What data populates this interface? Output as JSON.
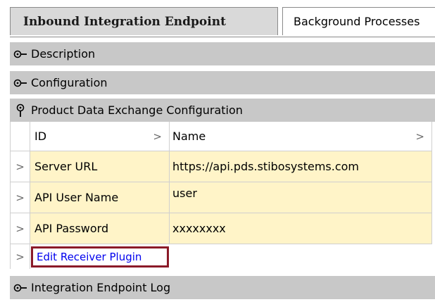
{
  "tabs": [
    {
      "label": "Inbound Integration Endpoint",
      "active": true
    },
    {
      "label": "Background Processes",
      "active": false
    }
  ],
  "sections": {
    "description": {
      "label": "Description",
      "expanded": false
    },
    "configuration": {
      "label": "Configuration",
      "expanded": false
    },
    "pdx": {
      "label": "Product Data Exchange Configuration",
      "expanded": true
    },
    "log": {
      "label": "Integration Endpoint Log",
      "expanded": false
    }
  },
  "table": {
    "columns": [
      {
        "label": "ID",
        "arrow": ">"
      },
      {
        "label": "Name",
        "arrow": ">"
      }
    ],
    "rows": [
      {
        "arrow": ">",
        "id": "Server URL",
        "name": "https://api.pds.stibosystems.com"
      },
      {
        "arrow": ">",
        "id": "API User Name",
        "name": "user"
      },
      {
        "arrow": ">",
        "id": "API Password",
        "name": "xxxxxxxx"
      }
    ],
    "action_row": {
      "arrow": ">",
      "link": "Edit Receiver Plugin"
    }
  },
  "colors": {
    "section_bg": "#c8c8c8",
    "tab_active_bg": "#d9d9d9",
    "cell_highlight": "#fff4c8",
    "link": "#0000ee",
    "highlight_border": "#8b1a28"
  },
  "icons": {
    "collapsed": "collapsed-node-icon",
    "expanded": "expanded-node-icon"
  }
}
